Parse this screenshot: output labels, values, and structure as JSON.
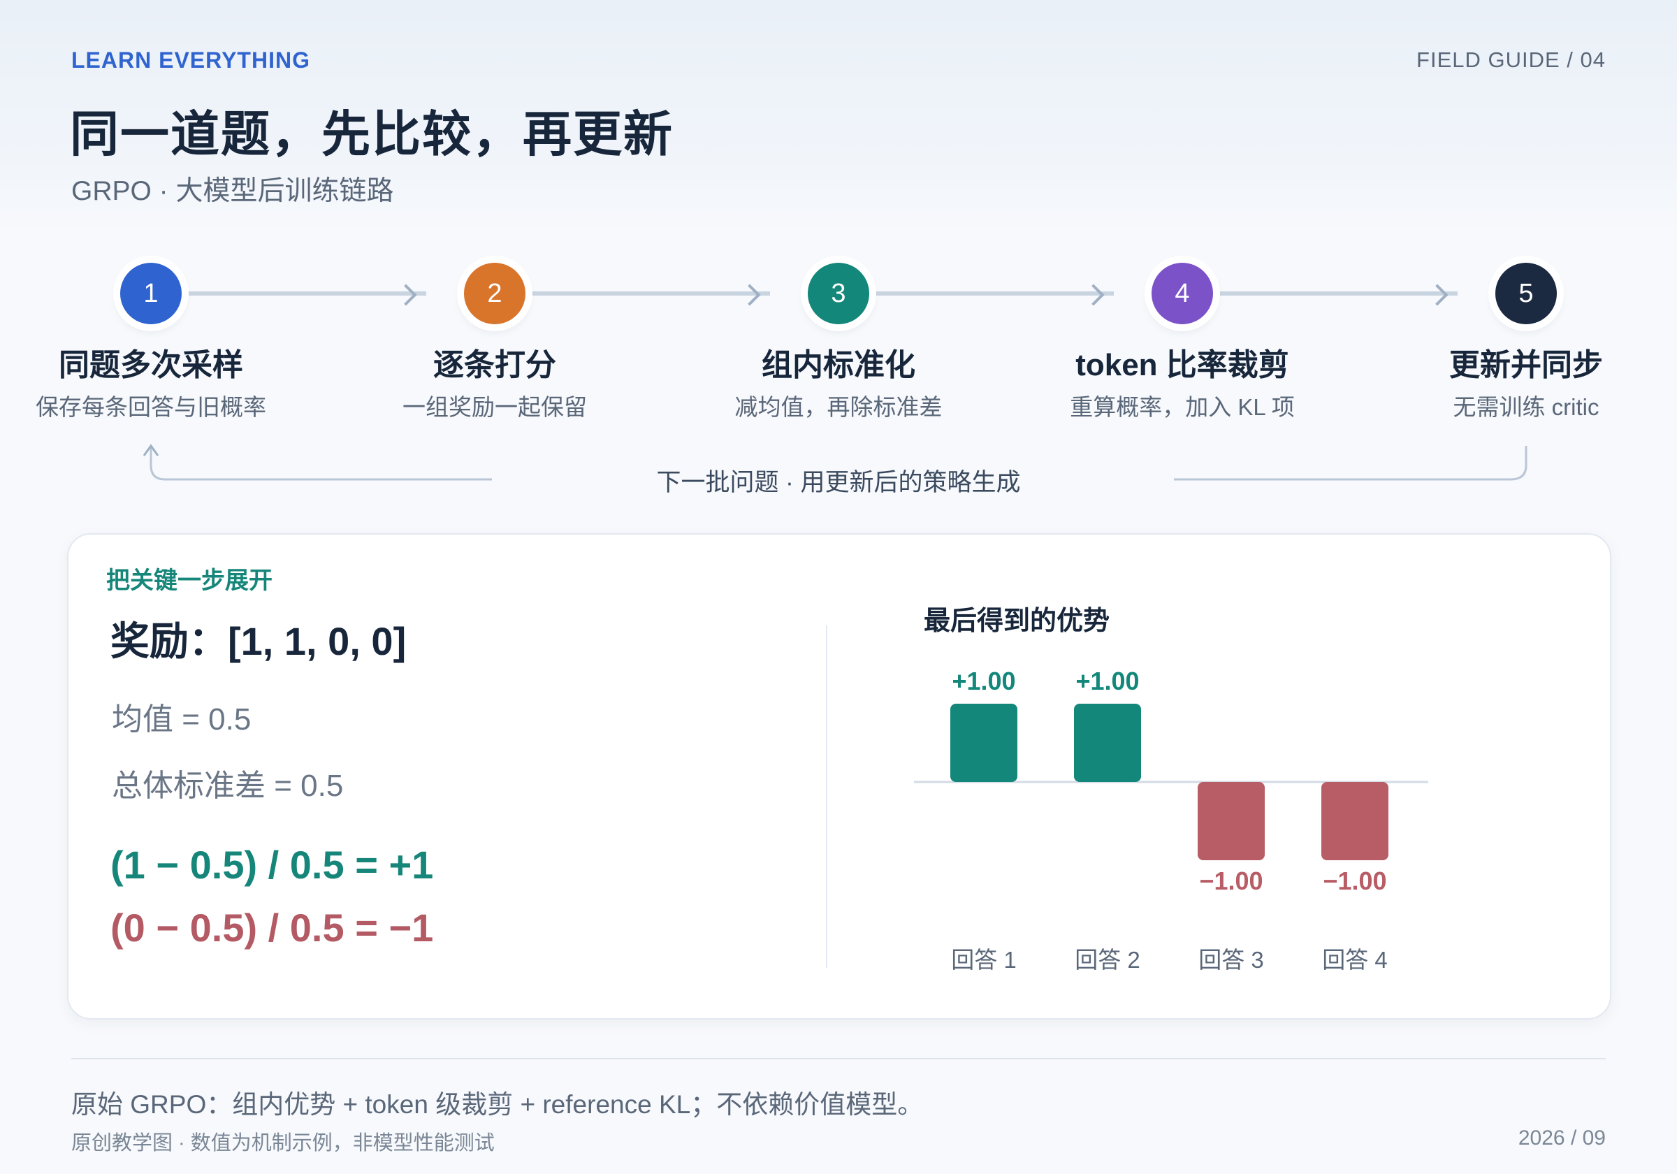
{
  "header": {
    "kicker": "LEARN EVERYTHING",
    "guide": "FIELD GUIDE / 04",
    "title": "同一道题，先比较，再更新",
    "subtitle": "GRPO · 大模型后训练链路"
  },
  "steps": [
    {
      "num": "1",
      "title": "同题多次采样",
      "desc": "保存每条回答与旧概率",
      "color": "#2f64d0"
    },
    {
      "num": "2",
      "title": "逐条打分",
      "desc": "一组奖励一起保留",
      "color": "#d9752b"
    },
    {
      "num": "3",
      "title": "组内标准化",
      "desc": "减均值，再除标准差",
      "color": "#12877a"
    },
    {
      "num": "4",
      "title": "token 比率裁剪",
      "desc": "重算概率，加入 KL 项",
      "color": "#7b52c8"
    },
    {
      "num": "5",
      "title": "更新并同步",
      "desc": "无需训练 critic",
      "color": "#1b2a40"
    }
  ],
  "loop": {
    "label": "下一批问题 · 用更新后的策略生成"
  },
  "card": {
    "kicker": "把关键一步展开",
    "reward": "奖励：[1, 1, 0, 0]",
    "mean": "均值 = 0.5",
    "std": "总体标准差 = 0.5",
    "eq_pos": "(1 − 0.5) / 0.5 = +1",
    "eq_neg": "(0 − 0.5) / 0.5 = −1",
    "chart_title": "最后得到的优势"
  },
  "chart_data": {
    "type": "bar",
    "title": "最后得到的优势",
    "categories": [
      "回答 1",
      "回答 2",
      "回答 3",
      "回答 4"
    ],
    "values": [
      1.0,
      1.0,
      -1.0,
      -1.0
    ],
    "value_labels": [
      "+1.00",
      "+1.00",
      "−1.00",
      "−1.00"
    ],
    "ylim": [
      -1,
      1
    ],
    "grid": false,
    "colors": {
      "positive": "#12877a",
      "negative": "#b85c66",
      "baseline": "#d3dbe5"
    }
  },
  "footer": {
    "note": "原始 GRPO：组内优势 + token 级裁剪 + reference KL；不依赖价值模型。",
    "small": "原创教学图 · 数值为机制示例，非模型性能测试",
    "date": "2026 / 09"
  }
}
